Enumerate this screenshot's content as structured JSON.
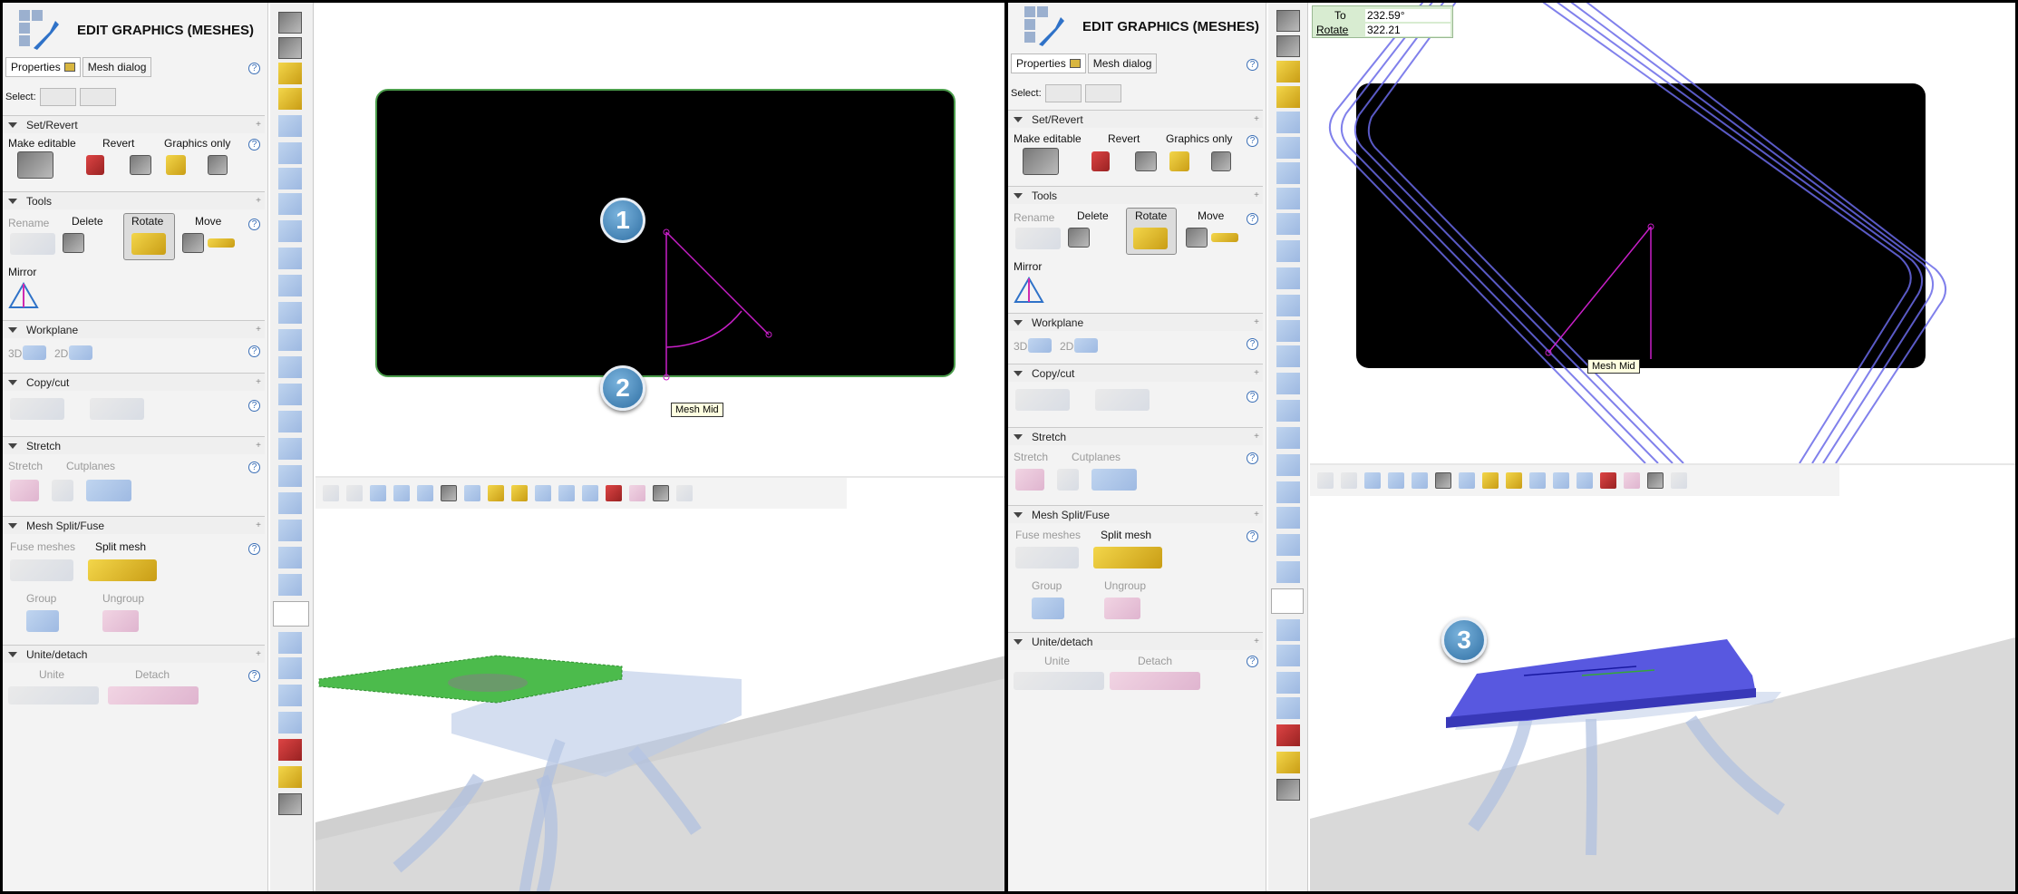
{
  "panel": {
    "title": "EDIT GRAPHICS (MESHES)",
    "tabs": [
      "Properties",
      "Mesh dialog"
    ],
    "select_label": "Select:",
    "sections": {
      "set_revert": {
        "title": "Set/Revert",
        "make_editable": "Make editable",
        "revert": "Revert",
        "graphics_only": "Graphics only"
      },
      "tools": {
        "title": "Tools",
        "rename": "Rename",
        "delete": "Delete",
        "rotate": "Rotate",
        "move": "Move",
        "mirror": "Mirror"
      },
      "workplane": {
        "title": "Workplane",
        "3d": "3D",
        "2d": "2D"
      },
      "copy_cut": {
        "title": "Copy/cut"
      },
      "stretch": {
        "title": "Stretch",
        "stretch": "Stretch",
        "cutplanes": "Cutplanes"
      },
      "mesh_split": {
        "title": "Mesh Split/Fuse",
        "fuse": "Fuse meshes",
        "split": "Split mesh",
        "group": "Group",
        "ungroup": "Ungroup"
      },
      "unite": {
        "title": "Unite/detach",
        "unite": "Unite",
        "detach": "Detach"
      }
    }
  },
  "help_glyph": "?",
  "tooltip": "Mesh Mid",
  "badges": [
    "1",
    "2",
    "3"
  ],
  "rotate_readout": {
    "to_label": "To",
    "to_value": "232.59°",
    "rotate_label": "Rotate",
    "rotate_value": "322.21"
  },
  "colors": {
    "selection_green": "#4cbb4c",
    "mesh_blue": "#6a6ae8",
    "guide_magenta": "#c81fc8"
  },
  "icons": [
    "wrench-icon",
    "camera-icon",
    "home-icon",
    "person-icon",
    "pdf-icon",
    "magnet-icon",
    "flask-icon",
    "film-icon"
  ]
}
